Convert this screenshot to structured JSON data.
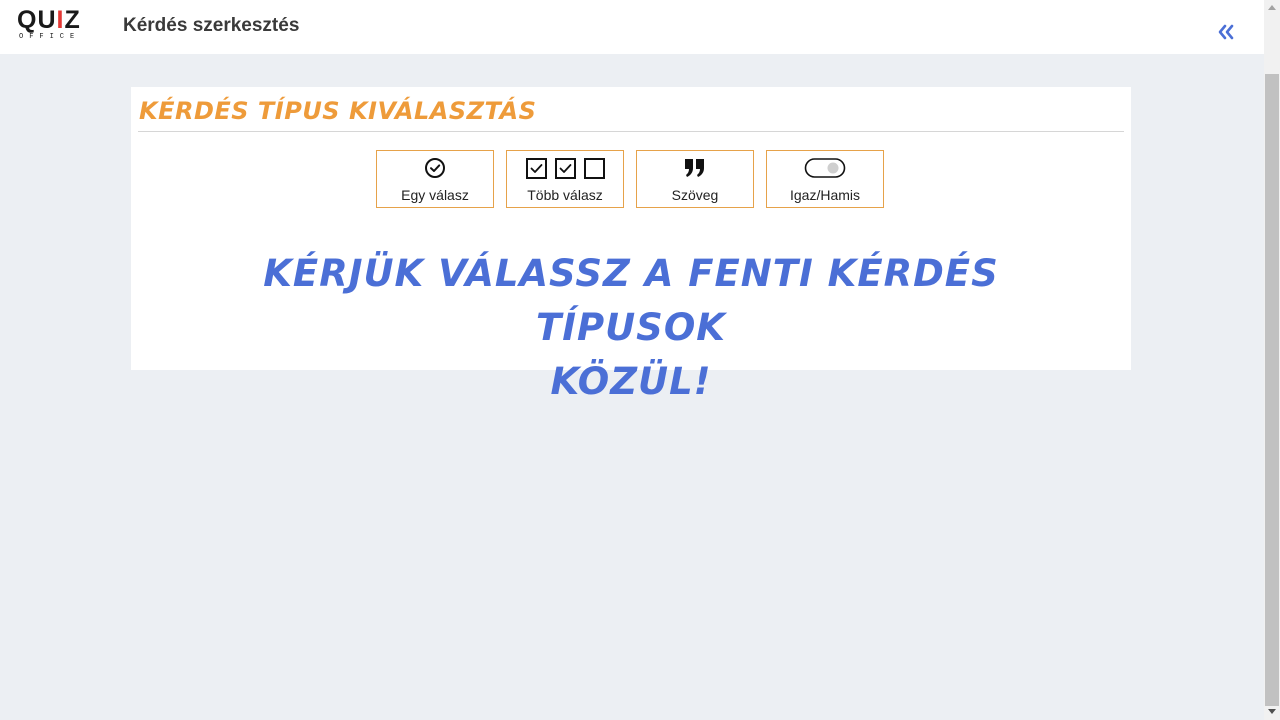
{
  "header": {
    "logo_word": [
      "Q",
      "U",
      "I",
      "Z"
    ],
    "logo_sub": "OFFICE",
    "page_title": "Kérdés szerkesztés",
    "collapse_icon": "double-chevron-left-icon"
  },
  "colors": {
    "background": "#eceff3",
    "accent_orange": "#ee9b3a",
    "border_orange": "#e6a24a",
    "accent_blue": "#4b6fd6",
    "logo_letters": [
      "#1a1a1a",
      "#1a1a1a",
      "#e53935",
      "#1a1a1a"
    ]
  },
  "card": {
    "title": "KÉRDÉS TÍPUS KIVÁLASZTÁS",
    "types": [
      {
        "label": "Egy válasz",
        "icon": "check-circle-icon"
      },
      {
        "label": "Több válasz",
        "icon": "checkbox-group-icon"
      },
      {
        "label": "Szöveg",
        "icon": "quote-icon"
      },
      {
        "label": "Igaz/Hamis",
        "icon": "toggle-icon"
      }
    ],
    "prompt_line1": "KÉRJÜK VÁLASSZ A FENTI KÉRDÉS TÍPUSOK",
    "prompt_line2": "KÖZÜL!"
  }
}
